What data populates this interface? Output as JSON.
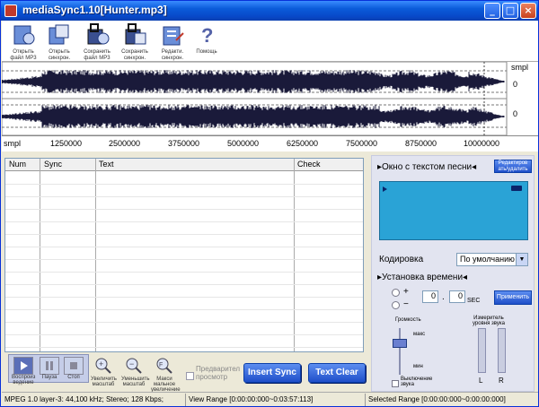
{
  "title": "mediaSync1.10[Hunter.mp3]",
  "toolbar": [
    {
      "icon": "open-mp3-icon",
      "label": "Открыть\nфайл MP3"
    },
    {
      "icon": "open-sync-icon",
      "label": "Открыть\nсинхрон.\nаудио"
    },
    {
      "icon": "save-mp3-icon",
      "label": "Сохранить\nфайл MP3"
    },
    {
      "icon": "save-sync-icon",
      "label": "Сохранить\nсинхрон.\nаудио"
    },
    {
      "icon": "edit-sync-icon",
      "label": "Редакти.\nсинхрон."
    },
    {
      "icon": "help-icon",
      "label": "Помощь"
    }
  ],
  "wave": {
    "unit_top": "smpl",
    "zero_top": "0",
    "zero_bottom": "0",
    "unit_bottom": "smpl",
    "ticks": [
      "1250000",
      "2500000",
      "3750000",
      "5000000",
      "6250000",
      "7500000",
      "8750000",
      "10000000"
    ]
  },
  "table": {
    "columns": [
      "Num",
      "Sync",
      "Text",
      "Check"
    ]
  },
  "playback": [
    {
      "icon": "play-icon",
      "label": "Воспроиз\nведение"
    },
    {
      "icon": "pause-icon",
      "label": "Пауза"
    },
    {
      "icon": "stop-icon",
      "label": "Стоп"
    },
    {
      "icon": "zoom-in-icon",
      "label": "Увеличить\nмасштаб"
    },
    {
      "icon": "zoom-out-icon",
      "label": "Уменьшить\nмасштаб"
    },
    {
      "icon": "zoom-max-icon",
      "label": "Макси\nмальное\nувеличение"
    }
  ],
  "preview_checkbox": "Предварител\nпросмотр",
  "insert_sync": "Insert Sync",
  "text_clear": "Text Clear",
  "right": {
    "lyrics_header": "▸Окно с текстом песни◂",
    "edit_btn": "Редактиров\nать/удалить",
    "encoding_label": "Кодировка",
    "encoding_value": "По умолчанию",
    "time_header": "▸Установка времени◂",
    "plus": "+",
    "minus": "−",
    "sec_a": "0",
    "dot": ".",
    "sec_b": "0",
    "sec_unit": "SEC",
    "apply_btn": "Применить",
    "volume_label": "Громкость",
    "vol_max": "макс",
    "vol_min": "мин",
    "mute_label": "Выключение\nзвука",
    "level_label": "Измеритель\nуровня звука",
    "L": "L",
    "R": "R"
  },
  "status": {
    "codec": "MPEG 1.0 layer-3: 44,100 kHz; Stereo; 128 Kbps;",
    "view_range": "View Range [0:00:00:000~0:03:57:113]",
    "selected_range": "Selected Range [0:00:00:000~0:00:00:000]"
  },
  "colors": {
    "title_bar": "#0a5bd9",
    "lyric_box": "#2aa3d6",
    "button": "#1f4fc9",
    "wave": "#1a1a3a"
  }
}
